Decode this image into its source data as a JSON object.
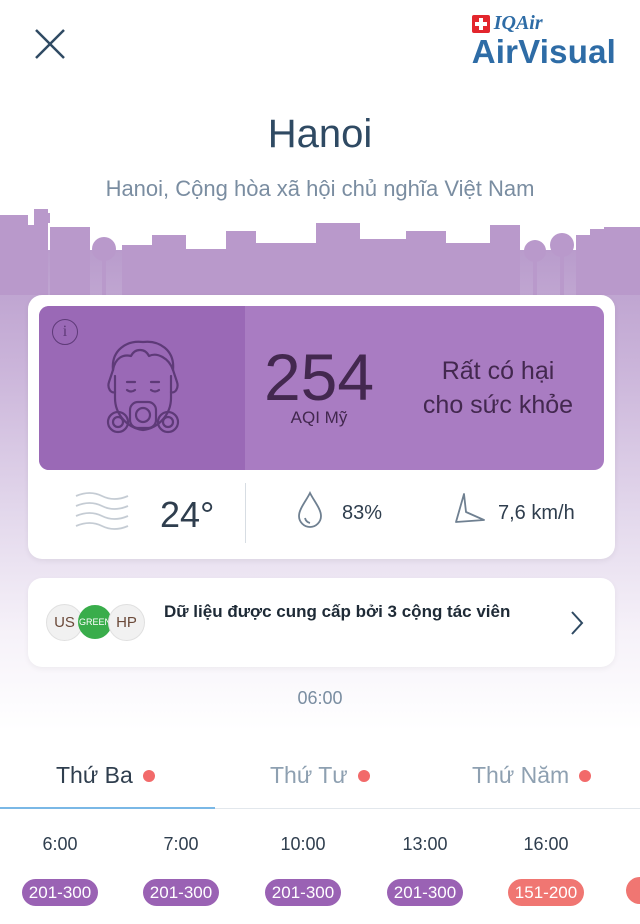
{
  "header": {
    "close_icon": "close-icon",
    "logo": {
      "brand_small": "IQAir",
      "brand_main": "AirVisual",
      "flag_icon": "swiss-flag-icon"
    }
  },
  "location": {
    "city": "Hanoi",
    "subtitle": "Hanoi, Cộng hòa xã hội chủ nghĩa Việt Nam"
  },
  "aqi": {
    "value": "254",
    "unit": "AQI Mỹ",
    "status_line1": "Rất có hại",
    "status_line2": "cho sức khỏe",
    "info_icon": "info-icon",
    "face_icon": "gas-mask-face-icon",
    "colors": {
      "panel": "#a97cc2",
      "panel_dark": "#9a69b6",
      "text": "#43284f"
    }
  },
  "weather": {
    "temperature": "24°",
    "humidity": "83%",
    "wind_speed": "7,6 km/h",
    "icons": [
      "wind-lines-icon",
      "humidity-drop-icon",
      "wind-flag-icon"
    ]
  },
  "contributors": {
    "badges": [
      "US",
      "GREEN",
      "HP"
    ],
    "text_prefix": "Dữ liệu được cung cấp bởi ",
    "text_bold": "3 cộng tác viên"
  },
  "forecast": {
    "time": "06:00",
    "tabs": [
      {
        "label": "Thứ Ba",
        "active": true
      },
      {
        "label": "Thứ Tư",
        "active": false
      },
      {
        "label": "Thứ Năm",
        "active": false
      }
    ],
    "hours": [
      {
        "time": "6:00",
        "range": "201-300"
      },
      {
        "time": "7:00",
        "range": "201-300"
      },
      {
        "time": "10:00",
        "range": "201-300"
      },
      {
        "time": "13:00",
        "range": "201-300"
      },
      {
        "time": "16:00",
        "range": "151-200"
      }
    ],
    "colors": {
      "very_unhealthy": "#9a62b4",
      "unhealthy": "#f07672",
      "dot": "#f26a6a"
    }
  }
}
